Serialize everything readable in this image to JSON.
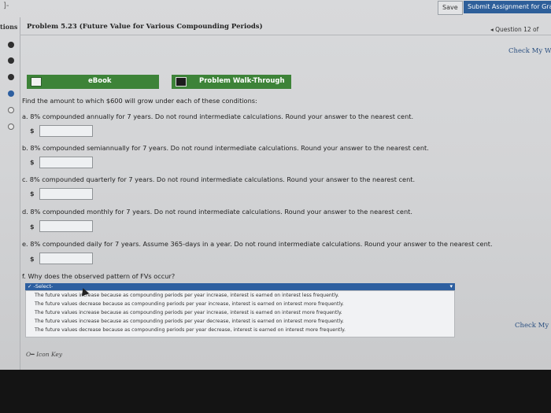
{
  "topbar": {
    "corner": "]-",
    "save_label": "Save",
    "submit_label": "Submit Assignment for Grad"
  },
  "sidebar": {
    "label": "tions"
  },
  "problem": {
    "title": "Problem 5.23 (Future Value for Various Compounding Periods)"
  },
  "nav": {
    "question": "◂ Question 12 of",
    "check_top": "Check My W",
    "check_bottom": "Check My"
  },
  "tabs": {
    "ebook": "eBook",
    "walkthrough": "Problem Walk-Through"
  },
  "intro": "Find the amount to which $600 will grow under each of these conditions:",
  "parts": [
    "a. 8% compounded annually for 7 years. Do not round intermediate calculations. Round your answer to the nearest cent.",
    "b. 8% compounded semiannually for 7 years. Do not round intermediate calculations. Round your answer to the nearest cent.",
    "c. 8% compounded quarterly for 7 years. Do not round intermediate calculations. Round your answer to the nearest cent.",
    "d. 8% compounded monthly for 7 years. Do not round intermediate calculations. Round your answer to the nearest cent.",
    "e. 8% compounded daily for 7 years. Assume 365-days in a year. Do not round intermediate calculations. Round your answer to the nearest cent."
  ],
  "currency": "$",
  "question_f": "f. Why does the observed pattern of FVs occur?",
  "select": {
    "selected": "✓ -Select-",
    "options": [
      "The future values increase because as compounding periods per year increase, interest is earned on interest less frequently.",
      "The future values decrease because as compounding periods per year increase, interest is earned on interest more frequently.",
      "The future values increase because as compounding periods per year increase, interest is earned on interest more frequently.",
      "The future values increase because as compounding periods per year decrease, interest is earned on interest more frequently.",
      "The future values decrease because as compounding periods per year decrease, interest is earned on interest more frequently."
    ]
  },
  "icon_key": "Icon Key",
  "colors": {
    "accent": "#2d5fa0",
    "tab_green": "#3d8338"
  }
}
